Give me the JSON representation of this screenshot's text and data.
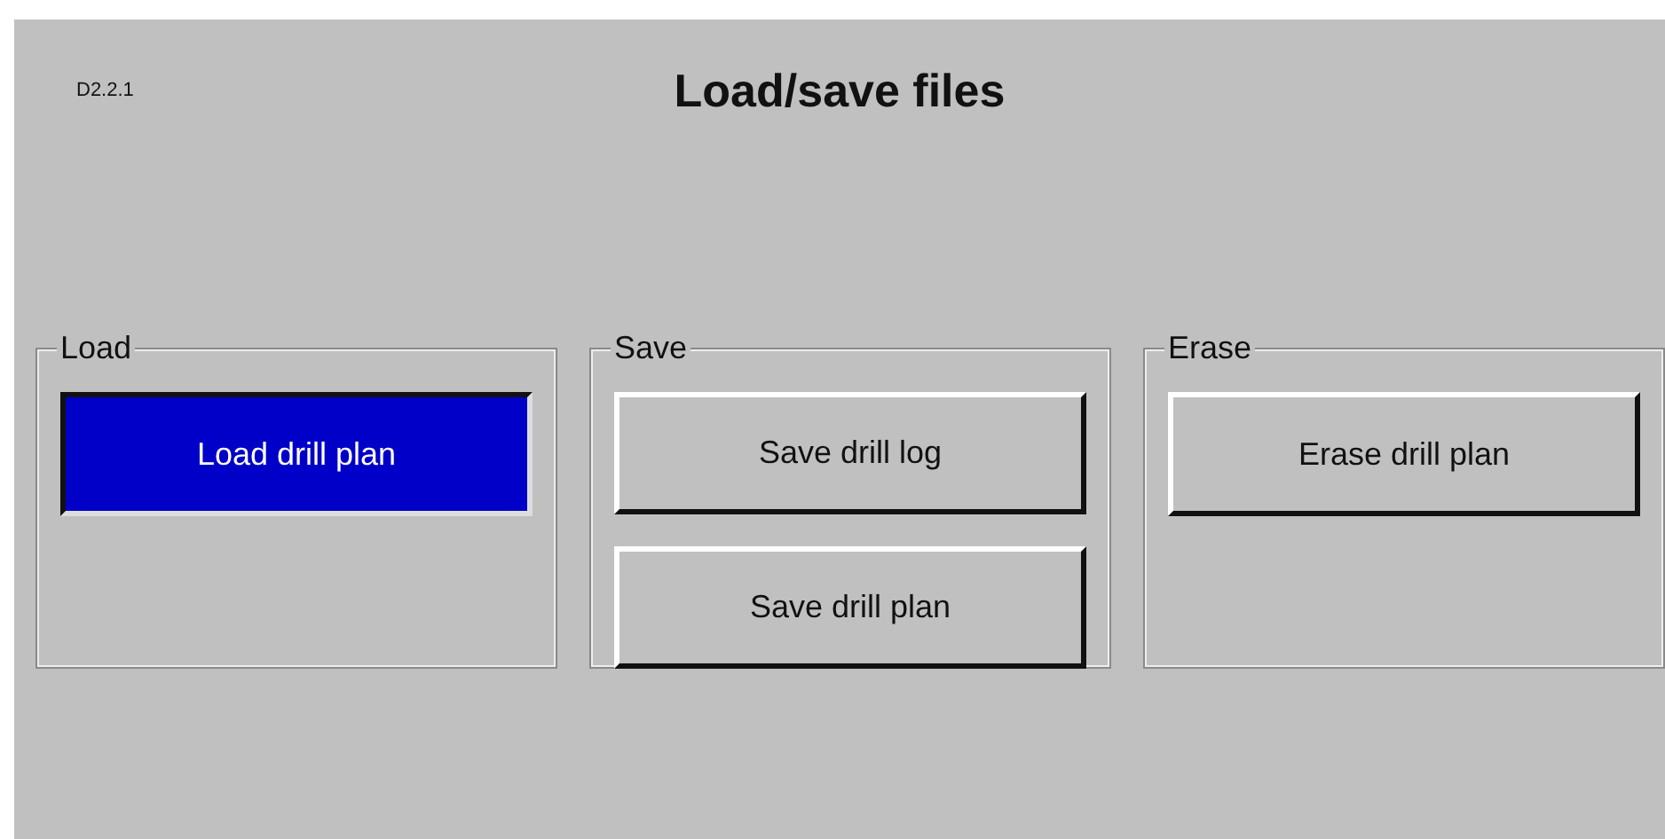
{
  "screen": {
    "code": "D2.2.1",
    "title": "Load/save files"
  },
  "groups": [
    {
      "label": "Load",
      "buttons": [
        {
          "label": "Load drill plan",
          "selected": true
        }
      ]
    },
    {
      "label": "Save",
      "buttons": [
        {
          "label": "Save drill log",
          "selected": false
        },
        {
          "label": "Save drill plan",
          "selected": false
        }
      ]
    },
    {
      "label": "Erase",
      "buttons": [
        {
          "label": "Erase drill plan",
          "selected": false
        }
      ]
    }
  ]
}
